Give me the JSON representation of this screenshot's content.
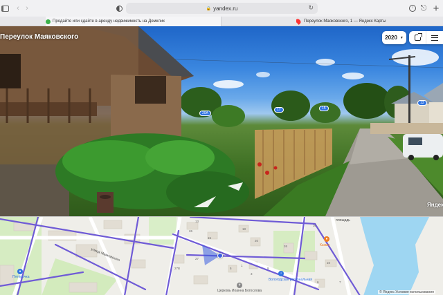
{
  "browser": {
    "url": "yandex.ru",
    "tabs": [
      {
        "label": "Продайте или сдайте в аренду недвижимость на Домклик"
      },
      {
        "label": "Переулок Маяковского, 1 — Яндекс Карты"
      }
    ]
  },
  "panorama": {
    "street_title": "Переулок Маяковского",
    "year_selector": "2020",
    "house_markers": [
      "20А",
      "17",
      "15",
      "13"
    ],
    "watermark": "Яндекс"
  },
  "map": {
    "streets": [
      "улица Маяковского",
      "площадь"
    ],
    "house_numbers": [
      "13",
      "18",
      "20",
      "26",
      "27",
      "27В",
      "15",
      "26",
      "1",
      "5",
      "30",
      "9",
      "3",
      "10",
      "6",
      "7"
    ],
    "pois": [
      {
        "label": "Пятёрочка",
        "color": "#2f73e0",
        "icon": "shop-icon"
      },
      {
        "label": "Кзамп",
        "color": "#f07d22",
        "icon": "cafe-icon"
      },
      {
        "label": "Вологодская региональная",
        "color": "#2f73e0",
        "icon": "info-icon"
      },
      {
        "label": "Церковь Иоанна Богослова",
        "color": "#8a8a8a",
        "icon": "church-icon"
      }
    ],
    "copyright": "© Яндекс   Условия использования"
  },
  "colors": {
    "marker_blue": "#2f73e0",
    "route_purple": "#6f5bd6",
    "water": "#9ed6f2"
  }
}
